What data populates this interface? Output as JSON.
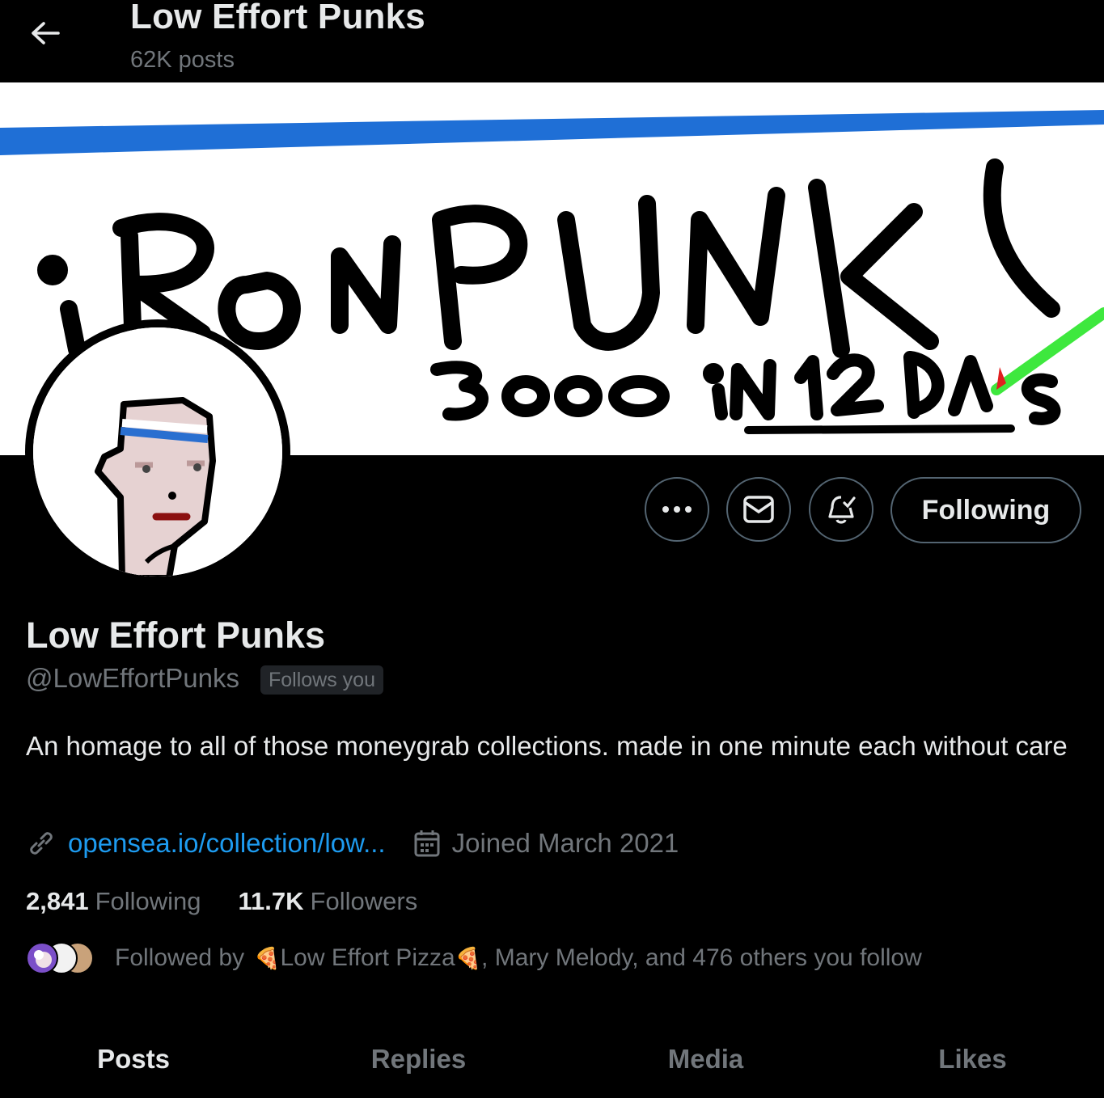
{
  "header": {
    "title": "Low Effort Punks",
    "posts_count": "62K posts"
  },
  "banner": {
    "text_main": "iRONPUNK",
    "text_sub": "3000 iN 12 DAYS"
  },
  "actions": {
    "following_label": "Following"
  },
  "profile": {
    "name": "Low Effort Punks",
    "handle": "@LowEffortPunks",
    "follows_you": "Follows you",
    "bio": "An homage to all of those moneygrab collections. made in one minute each without care",
    "link": "opensea.io/collection/low...",
    "joined": "Joined March 2021"
  },
  "stats": {
    "following_count": "2,841",
    "following_label": "Following",
    "followers_count": "11.7K",
    "followers_label": "Followers"
  },
  "followed_by": {
    "prefix": "Followed by",
    "name1": "Low Effort Pizza",
    "rest": ", Mary Melody, and 476 others you follow",
    "emoji": "🍕"
  },
  "tabs": [
    {
      "label": "Posts"
    },
    {
      "label": "Replies"
    },
    {
      "label": "Media"
    },
    {
      "label": "Likes"
    }
  ],
  "colors": {
    "background": "#000000",
    "accent": "#1d9bf0",
    "muted": "#71767b",
    "border": "#536471"
  }
}
